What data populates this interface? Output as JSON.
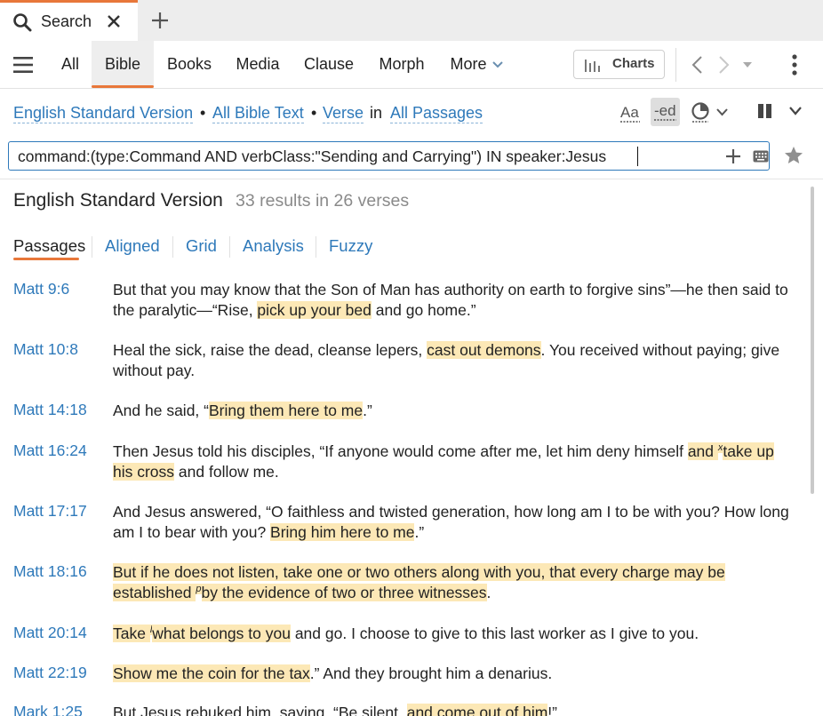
{
  "tab": {
    "label": "Search",
    "close_icon": "close-icon",
    "search_icon": "search-icon",
    "new_tab_icon": "plus-icon"
  },
  "nav": {
    "tabs": [
      {
        "label": "All",
        "active": false
      },
      {
        "label": "Bible",
        "active": true
      },
      {
        "label": "Books",
        "active": false
      },
      {
        "label": "Media",
        "active": false
      },
      {
        "label": "Clause",
        "active": false
      },
      {
        "label": "Morph",
        "active": false
      },
      {
        "label": "More",
        "active": false
      }
    ],
    "charts_label": "Charts"
  },
  "query": {
    "version": "English Standard Version",
    "scope": "All Bible Text",
    "unit": "Verse",
    "in_label": "in",
    "range": "All Passages",
    "bullet": "•",
    "text": "command:(type:Command AND verbClass:\"Sending and Carrying\") IN speaker:Jesus"
  },
  "results": {
    "title": "English Standard Version",
    "count": "33 results in 26 verses",
    "tabs": [
      "Passages",
      "Aligned",
      "Grid",
      "Analysis",
      "Fuzzy"
    ],
    "active_tab": "Passages"
  },
  "verses": [
    {
      "ref": "Matt 9:6",
      "parts": [
        {
          "t": "But that you may know that the Son of Man has authority on earth to forgive sins”—he then said to the paralytic—“Rise, ",
          "h": false
        },
        {
          "t": "pick up your bed",
          "h": true
        },
        {
          "t": " and go home.”",
          "h": false
        }
      ]
    },
    {
      "ref": "Matt 10:8",
      "parts": [
        {
          "t": "Heal the sick, raise the dead, cleanse lepers, ",
          "h": false
        },
        {
          "t": "cast out demons",
          "h": true
        },
        {
          "t": ". You received without paying; give without pay.",
          "h": false
        }
      ]
    },
    {
      "ref": "Matt 14:18",
      "parts": [
        {
          "t": "And he said, “",
          "h": false
        },
        {
          "t": "Bring them here to me",
          "h": true
        },
        {
          "t": ".”",
          "h": false
        }
      ]
    },
    {
      "ref": "Matt 16:24",
      "parts": [
        {
          "t": "Then Jesus told his disciples, “If anyone would come after me, let him deny himself ",
          "h": false
        },
        {
          "t": "and ",
          "h": true
        },
        {
          "sup": "x",
          "h": true
        },
        {
          "t": "take up his cross",
          "h": true
        },
        {
          "t": " and follow me.",
          "h": false
        }
      ]
    },
    {
      "ref": "Matt 17:17",
      "parts": [
        {
          "t": "And Jesus answered, “O faithless and twisted generation, how long am I to be with you? How long am I to bear with you? ",
          "h": false
        },
        {
          "t": "Bring him here to me",
          "h": true
        },
        {
          "t": ".”",
          "h": false
        }
      ]
    },
    {
      "ref": "Matt 18:16",
      "parts": [
        {
          "t": "But if he does not listen, take one or two others along with you, that every charge may be established ",
          "h": true
        },
        {
          "sup": "p",
          "h": true
        },
        {
          "t": "by the evidence of two or three witnesses",
          "h": true
        },
        {
          "t": ".",
          "h": false
        }
      ]
    },
    {
      "ref": "Matt 20:14",
      "parts": [
        {
          "t": "Take ",
          "h": true
        },
        {
          "sup": "l",
          "h": true
        },
        {
          "t": "what belongs to you",
          "h": true
        },
        {
          "t": " and go. I choose to give to this last worker as I give to you.",
          "h": false
        }
      ]
    },
    {
      "ref": "Matt 22:19",
      "parts": [
        {
          "t": "Show me the coin for the tax",
          "h": true
        },
        {
          "t": ".” And they brought him a denarius.",
          "h": false
        }
      ]
    },
    {
      "ref": "Mark 1:25",
      "parts": [
        {
          "t": "But Jesus rebuked him, saying, “Be silent, ",
          "h": false
        },
        {
          "t": "and come out of him",
          "h": true
        },
        {
          "t": "!”",
          "h": false
        }
      ]
    }
  ],
  "colors": {
    "accent": "#e8773a",
    "link": "#2e79ba",
    "highlight": "#fce8b6"
  }
}
